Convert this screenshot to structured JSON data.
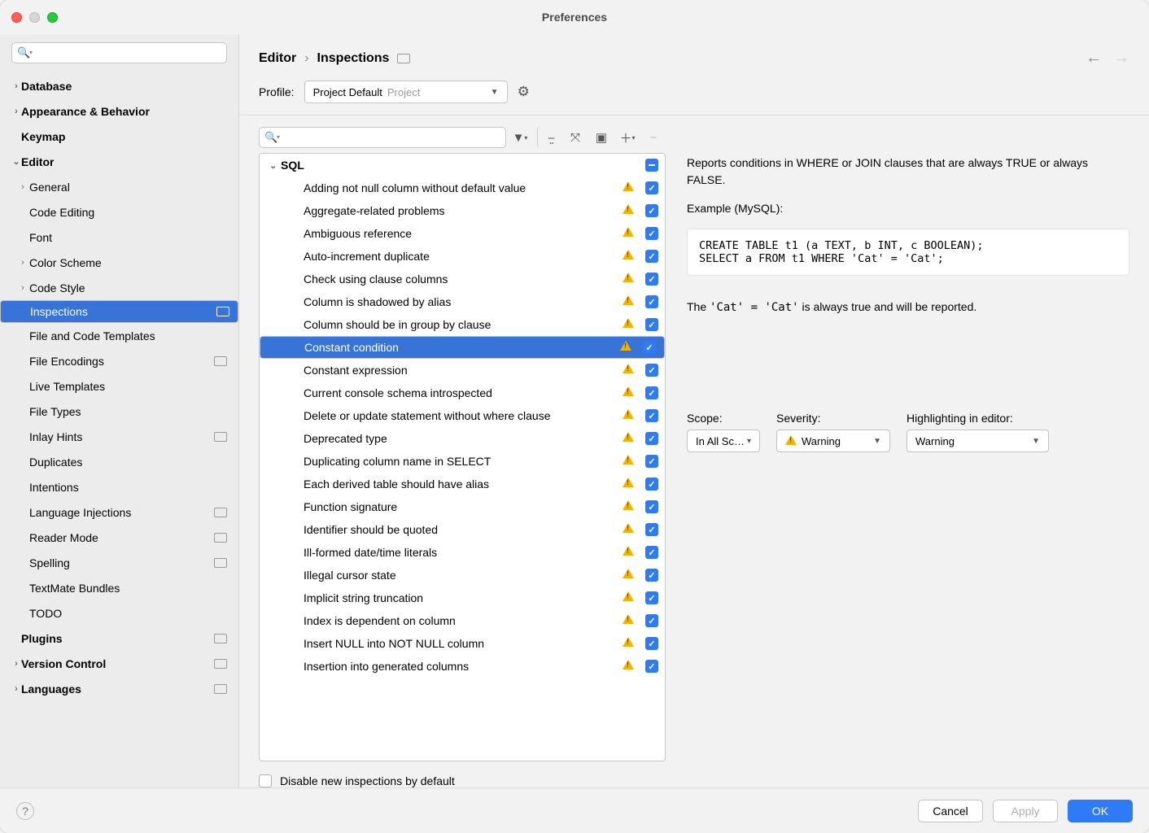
{
  "window": {
    "title": "Preferences"
  },
  "nav": {
    "back_enabled": true,
    "forward_enabled": false
  },
  "sidebar": {
    "search_placeholder": "",
    "items": [
      {
        "label": "Database",
        "level": 0,
        "arrow": "›",
        "bold": true
      },
      {
        "label": "Appearance & Behavior",
        "level": 0,
        "arrow": "›",
        "bold": true
      },
      {
        "label": "Keymap",
        "level": 0,
        "arrow": "",
        "bold": true
      },
      {
        "label": "Editor",
        "level": 0,
        "arrow": "⌄",
        "bold": true
      },
      {
        "label": "General",
        "level": 1,
        "arrow": "›"
      },
      {
        "label": "Code Editing",
        "level": 1,
        "arrow": ""
      },
      {
        "label": "Font",
        "level": 1,
        "arrow": ""
      },
      {
        "label": "Color Scheme",
        "level": 1,
        "arrow": "›"
      },
      {
        "label": "Code Style",
        "level": 1,
        "arrow": "›"
      },
      {
        "label": "Inspections",
        "level": 1,
        "arrow": "",
        "selected": true,
        "badge": true
      },
      {
        "label": "File and Code Templates",
        "level": 1,
        "arrow": ""
      },
      {
        "label": "File Encodings",
        "level": 1,
        "arrow": "",
        "badge": true
      },
      {
        "label": "Live Templates",
        "level": 1,
        "arrow": ""
      },
      {
        "label": "File Types",
        "level": 1,
        "arrow": ""
      },
      {
        "label": "Inlay Hints",
        "level": 1,
        "arrow": "",
        "badge": true
      },
      {
        "label": "Duplicates",
        "level": 1,
        "arrow": ""
      },
      {
        "label": "Intentions",
        "level": 1,
        "arrow": ""
      },
      {
        "label": "Language Injections",
        "level": 1,
        "arrow": "",
        "badge": true
      },
      {
        "label": "Reader Mode",
        "level": 1,
        "arrow": "",
        "badge": true
      },
      {
        "label": "Spelling",
        "level": 1,
        "arrow": "",
        "badge": true
      },
      {
        "label": "TextMate Bundles",
        "level": 1,
        "arrow": ""
      },
      {
        "label": "TODO",
        "level": 1,
        "arrow": ""
      },
      {
        "label": "Plugins",
        "level": 0,
        "arrow": "",
        "bold": true,
        "badge": true
      },
      {
        "label": "Version Control",
        "level": 0,
        "arrow": "›",
        "bold": true,
        "badge": true
      },
      {
        "label": "Languages",
        "level": 0,
        "arrow": "›",
        "bold": true,
        "badge": true
      }
    ]
  },
  "breadcrumb": {
    "parent": "Editor",
    "current": "Inspections"
  },
  "profile": {
    "label": "Profile:",
    "value": "Project Default",
    "hint": "Project"
  },
  "inspections": {
    "group": "SQL",
    "items": [
      {
        "name": "Adding not null column without default value",
        "checked": true
      },
      {
        "name": "Aggregate-related problems",
        "checked": true
      },
      {
        "name": "Ambiguous reference",
        "checked": true
      },
      {
        "name": "Auto-increment duplicate",
        "checked": true
      },
      {
        "name": "Check using clause columns",
        "checked": true
      },
      {
        "name": "Column is shadowed by alias",
        "checked": true
      },
      {
        "name": "Column should be in group by clause",
        "checked": true
      },
      {
        "name": "Constant condition",
        "checked": true,
        "selected": true
      },
      {
        "name": "Constant expression",
        "checked": true
      },
      {
        "name": "Current console schema introspected",
        "checked": true
      },
      {
        "name": "Delete or update statement without where clause",
        "checked": true
      },
      {
        "name": "Deprecated type",
        "checked": true
      },
      {
        "name": "Duplicating column name in SELECT",
        "checked": true
      },
      {
        "name": "Each derived table should have alias",
        "checked": true
      },
      {
        "name": "Function signature",
        "checked": true
      },
      {
        "name": "Identifier should be quoted",
        "checked": true
      },
      {
        "name": "Ill-formed date/time literals",
        "checked": true
      },
      {
        "name": "Illegal cursor state",
        "checked": true
      },
      {
        "name": "Implicit string truncation",
        "checked": true
      },
      {
        "name": "Index is dependent on column",
        "checked": true
      },
      {
        "name": "Insert NULL into NOT NULL column",
        "checked": true
      },
      {
        "name": "Insertion into generated columns",
        "checked": true
      }
    ]
  },
  "disable_label": "Disable new inspections by default",
  "detail": {
    "para1": "Reports conditions in WHERE or JOIN clauses that are always TRUE or always FALSE.",
    "example_label": "Example (MySQL):",
    "code": "CREATE TABLE t1 (a TEXT, b INT, c BOOLEAN);\nSELECT a FROM t1 WHERE 'Cat' = 'Cat';",
    "note_pre": "The ",
    "note_code": "'Cat' = 'Cat'",
    "note_post": " is always true and will be reported.",
    "scope_label": "Scope:",
    "scope_value": "In All Sc…",
    "severity_label": "Severity:",
    "severity_value": "Warning",
    "highlight_label": "Highlighting in editor:",
    "highlight_value": "Warning"
  },
  "footer": {
    "cancel": "Cancel",
    "apply": "Apply",
    "ok": "OK"
  }
}
